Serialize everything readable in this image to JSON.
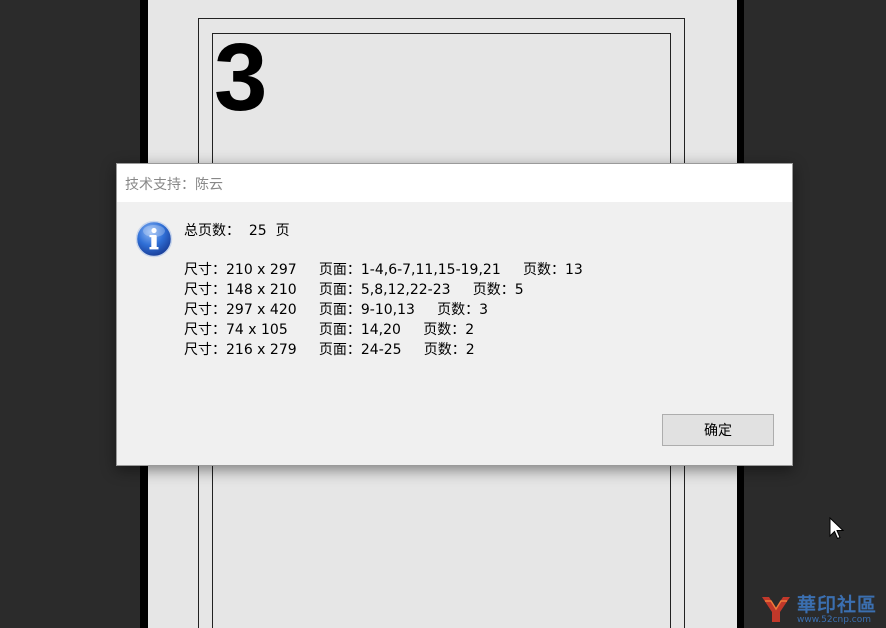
{
  "document": {
    "page_number": "3"
  },
  "dialog": {
    "title": "技术支持：陈云",
    "icon": "info-icon",
    "total_line": "总页数：  25  页",
    "size_rows": [
      "尺寸：210 x 297     页面：1-4,6-7,11,15-19,21     页数：13",
      "尺寸：148 x 210     页面：5,8,12,22-23     页数：5",
      "尺寸：297 x 420     页面：9-10,13     页数：3",
      "尺寸：74 x 105       页面：14,20     页数：2",
      "尺寸：216 x 279     页面：24-25     页数：2"
    ],
    "ok_label": "确定"
  },
  "watermark": {
    "brand": "華印社區",
    "url": "www.52cnp.com"
  },
  "colors": {
    "background": "#2b2b2b",
    "page": "#e6e6e6",
    "dialog_body": "#f0f0f0",
    "dialog_titlebar": "#ffffff",
    "title_text": "#888888",
    "watermark": "#3b6fb0"
  }
}
